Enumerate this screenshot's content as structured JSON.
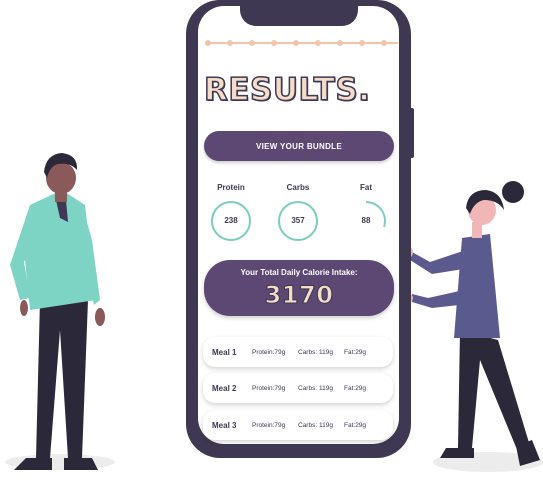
{
  "screen": {
    "title": "RESULTS.",
    "bundle_button_label": "VIEW YOUR BUNDLE",
    "macros": [
      {
        "label": "Protein",
        "value": "238",
        "progress": 1.0
      },
      {
        "label": "Carbs",
        "value": "357",
        "progress": 1.0
      },
      {
        "label": "Fat",
        "value": "88",
        "progress": 0.3
      }
    ],
    "calorie_label": "Your Total Daily Calorie Intake:",
    "calorie_value": "3170",
    "meals": [
      {
        "name": "Meal 1",
        "protein": "Protein:79g",
        "carbs": "Carbs: 119g",
        "fat": "Fat:29g"
      },
      {
        "name": "Meal 2",
        "protein": "Protein:79g",
        "carbs": "Carbs: 119g",
        "fat": "Fat:29g"
      },
      {
        "name": "Meal 3",
        "protein": "Protein:79g",
        "carbs": "Carbs: 119g",
        "fat": "Fat:29g"
      }
    ]
  },
  "colors": {
    "phone_frame": "#3e3852",
    "accent_purple": "#5c4872",
    "ring_teal": "#7ccfc0",
    "peach": "#f5dcc9",
    "progress_peach": "#f3c4aa"
  }
}
